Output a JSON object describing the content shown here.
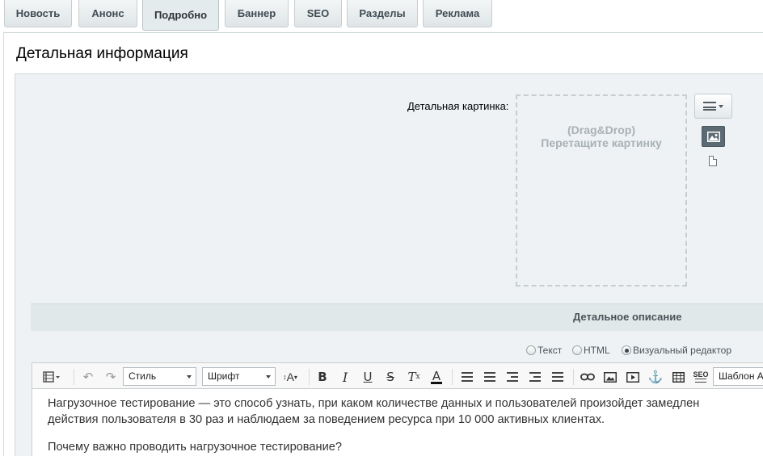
{
  "tabs": [
    {
      "label": "Новость"
    },
    {
      "label": "Анонс"
    },
    {
      "label": "Подробно"
    },
    {
      "label": "Баннер"
    },
    {
      "label": "SEO"
    },
    {
      "label": "Разделы"
    },
    {
      "label": "Реклама"
    }
  ],
  "active_tab": "Подробно",
  "section_title": "Детальная информация",
  "picture": {
    "label": "Детальная картинка:",
    "drop_line1": "(Drag&Drop)",
    "drop_line2": "Перетащите картинку"
  },
  "description": {
    "title": "Детальное описание",
    "modes": [
      {
        "label": "Текст",
        "checked": false
      },
      {
        "label": "HTML",
        "checked": false
      },
      {
        "label": "Визуальный редактор",
        "checked": true
      }
    ]
  },
  "toolbar": {
    "style_select": "Стиль",
    "font_select": "Шрифт",
    "template_select": "Шаблон А",
    "seo_label": "SEO",
    "icons": [
      "view-mode-icon",
      "undo-icon",
      "redo-icon",
      "font-size-icon",
      "bold-icon",
      "italic-icon",
      "underline-icon",
      "strikethrough-icon",
      "remove-format-icon",
      "text-color-icon",
      "ordered-list-icon",
      "unordered-list-icon",
      "outdent-icon",
      "indent-icon",
      "align-icon",
      "link-icon",
      "image-icon",
      "video-icon",
      "anchor-icon",
      "table-icon",
      "seo-icon"
    ]
  },
  "editor": {
    "line1": "Нагрузочное тестирование —  это способ узнать, при каком количестве данных и пользователей произойдет замедлен",
    "line2": "действия пользователя в 30 раз и наблюдаем за поведением ресурса при 10 000 активных клиентах.",
    "line3": "Почему важно проводить нагрузочное тестирование?"
  }
}
